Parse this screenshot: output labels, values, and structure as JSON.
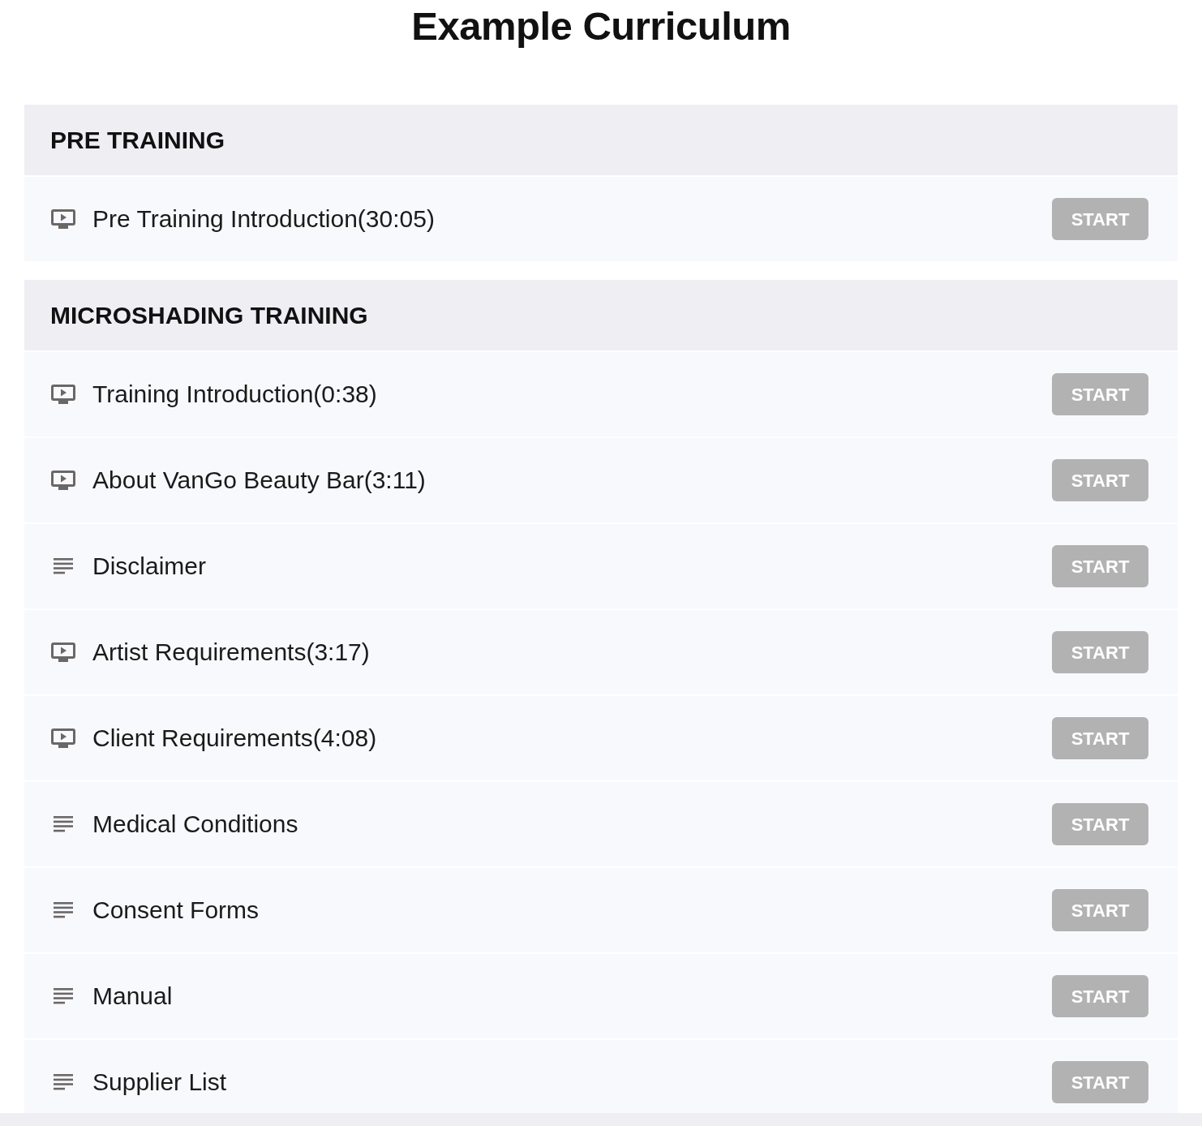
{
  "title": "Example Curriculum",
  "sections": [
    {
      "title": "PRE TRAINING",
      "lessons": [
        {
          "kind": "video",
          "title": "Pre Training Introduction(30:05)",
          "button": "START"
        }
      ]
    },
    {
      "title": "MICROSHADING TRAINING",
      "lessons": [
        {
          "kind": "video",
          "title": "Training Introduction(0:38)",
          "button": "START"
        },
        {
          "kind": "video",
          "title": "About VanGo Beauty Bar(3:11)",
          "button": "START"
        },
        {
          "kind": "text",
          "title": "Disclaimer",
          "button": "START"
        },
        {
          "kind": "video",
          "title": "Artist Requirements(3:17)",
          "button": "START"
        },
        {
          "kind": "video",
          "title": "Client Requirements(4:08)",
          "button": "START"
        },
        {
          "kind": "text",
          "title": "Medical Conditions",
          "button": "START"
        },
        {
          "kind": "text",
          "title": "Consent Forms",
          "button": "START"
        },
        {
          "kind": "text",
          "title": "Manual",
          "button": "START"
        },
        {
          "kind": "text",
          "title": "Supplier List",
          "button": "START"
        }
      ]
    }
  ]
}
